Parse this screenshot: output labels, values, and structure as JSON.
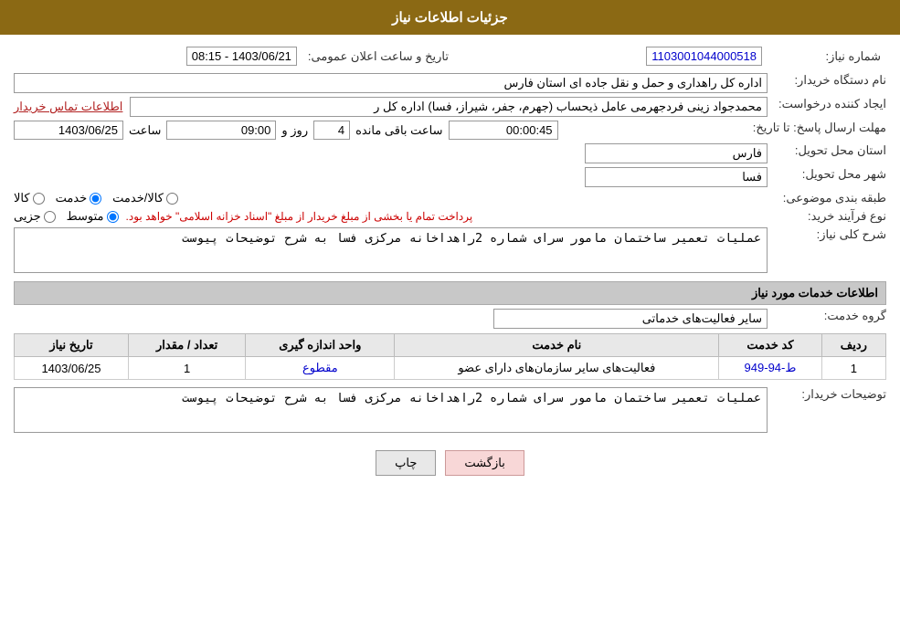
{
  "page": {
    "title": "جزئیات اطلاعات نیاز",
    "sections": {
      "need_info": "جزئیات اطلاعات نیاز",
      "service_info": "اطلاعات خدمات مورد نیاز"
    }
  },
  "fields": {
    "need_number_label": "شماره نیاز:",
    "need_number_value": "1103001044000518",
    "org_name_label": "نام دستگاه خریدار:",
    "org_name_value": "اداره کل راهداری و حمل و نقل جاده ای استان فارس",
    "creator_label": "ایجاد کننده درخواست:",
    "creator_value": "محمدجواد زینی فردجهرمی عامل ذیحساب (جهرم، جفر، شیراز، فسا) اداره کل ر",
    "creator_link": "اطلاعات تماس خریدار",
    "deadline_label": "مهلت ارسال پاسخ: تا تاریخ:",
    "deadline_date": "1403/06/25",
    "deadline_time_label": "ساعت",
    "deadline_time": "09:00",
    "deadline_days_label": "روز و",
    "deadline_days": "4",
    "deadline_remaining_label": "ساعت باقی مانده",
    "deadline_remaining": "00:00:45",
    "announce_datetime_label": "تاریخ و ساعت اعلان عمومی:",
    "announce_datetime_value": "1403/06/21 - 08:15",
    "province_label": "استان محل تحویل:",
    "province_value": "فارس",
    "city_label": "شهر محل تحویل:",
    "city_value": "فسا",
    "category_label": "طبقه بندی موضوعی:",
    "category_options": [
      "کالا",
      "خدمت",
      "کالا/خدمت"
    ],
    "category_selected": "خدمت",
    "process_label": "نوع فرآیند خرید:",
    "process_options": [
      "جزیی",
      "متوسط"
    ],
    "process_selected": "متوسط",
    "process_note": "پرداخت تمام یا بخشی از مبلغ خریدار از مبلغ \"اسناد خزانه اسلامی\" خواهد بود.",
    "description_label": "شرح کلی نیاز:",
    "description_value": "عملیات تعمیر ساختمان مامور سرای شماره 2راهداخانه مرکزی فسا به شرح توضیحات پیوست",
    "service_group_label": "گروه خدمت:",
    "service_group_value": "سایر فعالیت‌های خدماتی"
  },
  "table": {
    "headers": [
      "ردیف",
      "کد خدمت",
      "نام خدمت",
      "واحد اندازه گیری",
      "تعداد / مقدار",
      "تاریخ نیاز"
    ],
    "rows": [
      {
        "row": "1",
        "code": "ط-94-949",
        "name": "فعالیت‌های سایر سازمان‌های دارای عضو",
        "unit": "مقطوع",
        "count": "1",
        "date": "1403/06/25"
      }
    ]
  },
  "buyer_desc_label": "توضیحات خریدار:",
  "buyer_desc_value": "عملیات تعمیر ساختمان مامور سرای شماره 2راهداخانه مرکزی فسا به شرح توضیحات پیوست",
  "buttons": {
    "print": "چاپ",
    "back": "بازگشت"
  }
}
